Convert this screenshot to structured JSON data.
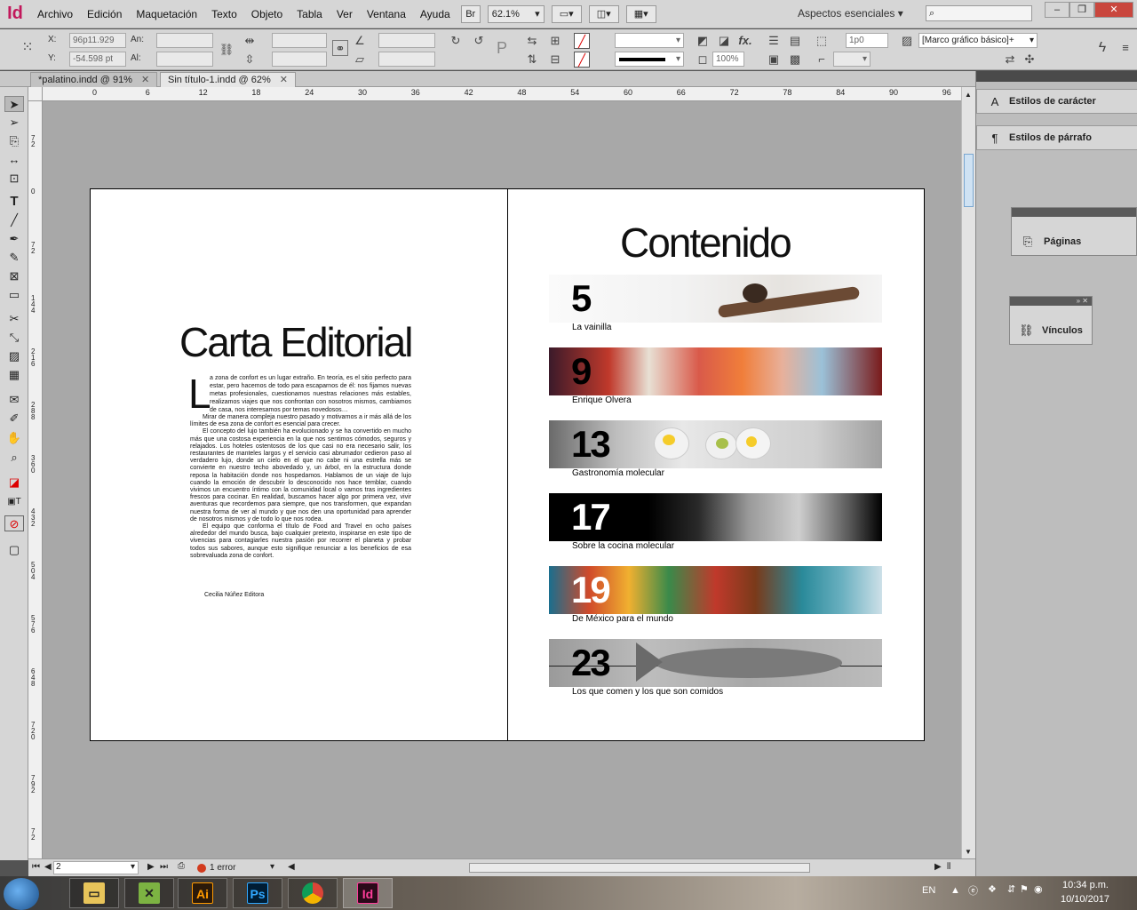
{
  "app": {
    "logo": "Id"
  },
  "menu": [
    "Archivo",
    "Edición",
    "Maquetación",
    "Texto",
    "Objeto",
    "Tabla",
    "Ver",
    "Ventana",
    "Ayuda"
  ],
  "menubar": {
    "bridge_label": "Br",
    "zoom": "62.1%",
    "workspace": "Aspectos esenciales",
    "workspace_arrow": "▾",
    "win_min": "–",
    "win_restore": "❐",
    "win_close": "✕"
  },
  "control": {
    "x_label": "X:",
    "x_value": "96p11.929",
    "y_label": "Y:",
    "y_value": "-54.598 pt",
    "w_label": "An:",
    "h_label": "Al:",
    "stroke_weight": "1p0",
    "scale": "100%",
    "object_style": "[Marco gráfico básico]+"
  },
  "tabs": [
    {
      "label": "*palatino.indd @ 91%",
      "close": "✕",
      "active": false
    },
    {
      "label": "Sin título-1.indd @ 62%",
      "close": "✕",
      "active": true
    }
  ],
  "ruler": {
    "top": [
      "0",
      "6",
      "12",
      "18",
      "24",
      "30",
      "36",
      "42",
      "48",
      "54",
      "60",
      "66",
      "72",
      "78",
      "84",
      "90",
      "96"
    ],
    "left": [
      "72",
      "0",
      "72",
      "144",
      "216",
      "288",
      "360",
      "432",
      "504",
      "576",
      "648",
      "720",
      "792",
      "72"
    ]
  },
  "page": {
    "left_title": "Carta Editorial",
    "dropcap": "L",
    "first_para": "a zona de confort es un lugar extraño. En teoría, es el sitio perfecto para estar, pero hacemos de todo para escaparnos de él: nos fijamos nuevas metas profesionales, cuestionamos nuestras relaciones más estables, realizamos viajes que nos confrontan con nosotros mismos, cambiamos de casa, nos interesamos por temas novedosos…",
    "paras": [
      "Mirar de manera compleja nuestro pasado y motivarnos a ir más allá de los límites de esa zona de confort es esencial para crecer.",
      "El concepto del lujo también ha evolucionado y se ha convertido en mucho más que una costosa experiencia en la que nos sentimos cómodos, seguros y relajados. Los hoteles ostentosos de los que casi no era necesario salir, los restaurantes de manteles largos y el servicio casi abrumador cedieron paso al verdadero lujo, donde un cielo en el que no cabe ni una estrella más se convierte en nuestro techo abovedado y, un árbol, en la estructura donde reposa la habitación donde nos hospedamos. Hablamos de un viaje de lujo cuando la emoción de descubrir lo desconocido nos hace temblar, cuando vivimos un encuentro íntimo con la comunidad local o vamos tras ingredientes frescos para cocinar. En realidad, buscamos hacer algo por primera vez, vivir aventuras que recordemos para siempre, que nos transformen, que expandan nuestra forma de ver al mundo y que nos den una oportunidad para aprender de nosotros mismos y de todo lo que nos rodea.",
      "El equipo que conforma el título de Food and Travel en ocho países alrededor del mundo busca, bajo cualquier pretexto, inspirarse en este tipo de vivencias para contagiarles nuestra pasión por recorrer el planeta y probar todos sus sabores, aunque esto signifique renunciar a los beneficios de esa sobrevaluada zona de confort."
    ],
    "signature": "Cecilia Núñez Editora",
    "right_title": "Contenido",
    "toc": [
      {
        "num": "5",
        "label": "La vainilla"
      },
      {
        "num": "9",
        "label": "Enrique Olvera"
      },
      {
        "num": "13",
        "label": "Gastronomía molecular"
      },
      {
        "num": "17",
        "label": "Sobre la cocina molecular"
      },
      {
        "num": "19",
        "label": "De México para el mundo"
      },
      {
        "num": "23",
        "label": "Los que comen y los que son comidos"
      }
    ]
  },
  "status": {
    "page_number": "2",
    "errors": "1 error"
  },
  "panels": {
    "char_styles": "Estilos de carácter",
    "para_styles": "Estilos de párrafo",
    "pages": "Páginas",
    "links": "Vínculos"
  },
  "tray": {
    "lang": "EN",
    "time": "10:34 p.m.",
    "date": "10/10/2017"
  },
  "taskbar": {
    "ai": "Ai",
    "ps": "Ps",
    "id": "Id"
  },
  "colors": {
    "indesign": "#c2185b",
    "illustrator": "#ff9a00",
    "photoshop": "#31a8ff"
  },
  "icons": [
    "selection-tool-icon",
    "direct-selection-icon",
    "type-tool-icon",
    "pen-icon",
    "hand-icon",
    "zoom-icon",
    "search-icon",
    "chrome-icon",
    "folder-icon"
  ]
}
